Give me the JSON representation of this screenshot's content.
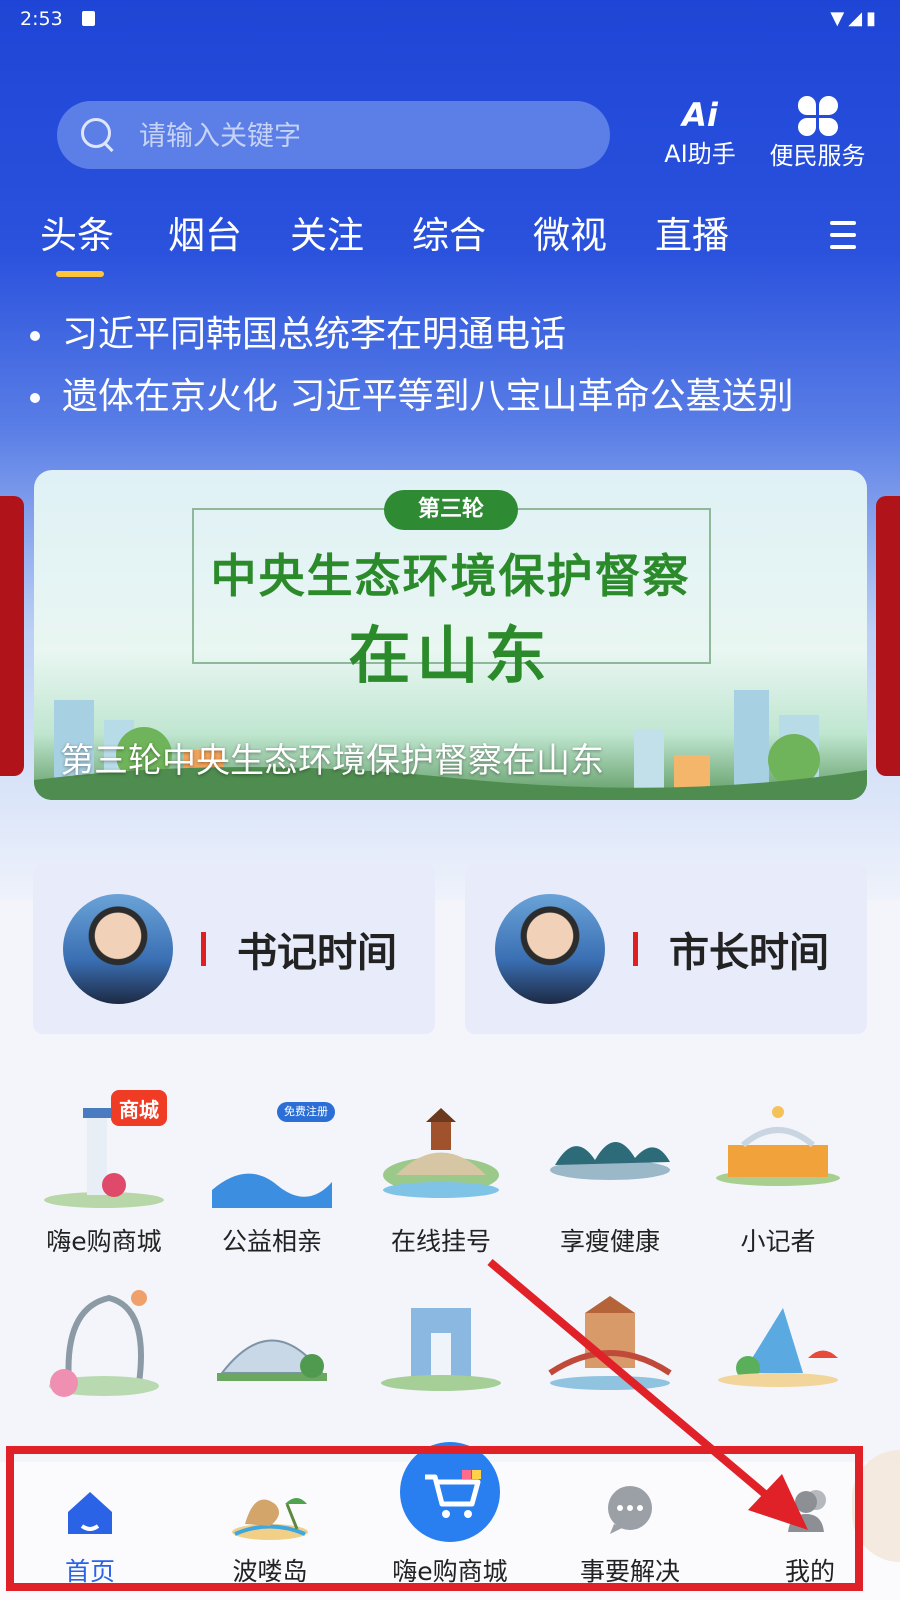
{
  "status_bar": {
    "time": "2:53"
  },
  "search": {
    "placeholder": "请输入关键字"
  },
  "top_actions": {
    "ai_label": "AI助手",
    "service_label": "便民服务"
  },
  "tabs": [
    {
      "label": "头条",
      "active": true
    },
    {
      "label": "烟台"
    },
    {
      "label": "关注"
    },
    {
      "label": "综合"
    },
    {
      "label": "微视"
    },
    {
      "label": "直播"
    }
  ],
  "headlines": [
    "习近平同韩国总统李在明通电话",
    "遗体在京火化 习近平等到八宝山革命公墓送别"
  ],
  "banner": {
    "pill": "第三轮",
    "title_line1": "中央生态环境保护督察",
    "title_line2": "在山东",
    "caption": "第三轮中央生态环境保护督察在山东"
  },
  "leaders": [
    {
      "label": "书记时间"
    },
    {
      "label": "市长时间"
    }
  ],
  "services_row1": [
    {
      "label": "嗨e购商城",
      "badge": "商城"
    },
    {
      "label": "公益相亲",
      "badge": "免费注册"
    },
    {
      "label": "在线挂号"
    },
    {
      "label": "享瘦健康"
    },
    {
      "label": "小记者"
    }
  ],
  "bottom_nav": [
    {
      "label": "首页",
      "icon": "home-icon",
      "active": true
    },
    {
      "label": "波喽岛",
      "icon": "island-icon"
    },
    {
      "label": "嗨e购商城",
      "icon": "cart-icon"
    },
    {
      "label": "事要解决",
      "icon": "chat-icon"
    },
    {
      "label": "我的",
      "icon": "user-icon"
    }
  ],
  "colors": {
    "primary": "#2b63e6",
    "header": "#1f45d6",
    "accent_underline": "#ffc53a",
    "annotation": "#e12128"
  }
}
